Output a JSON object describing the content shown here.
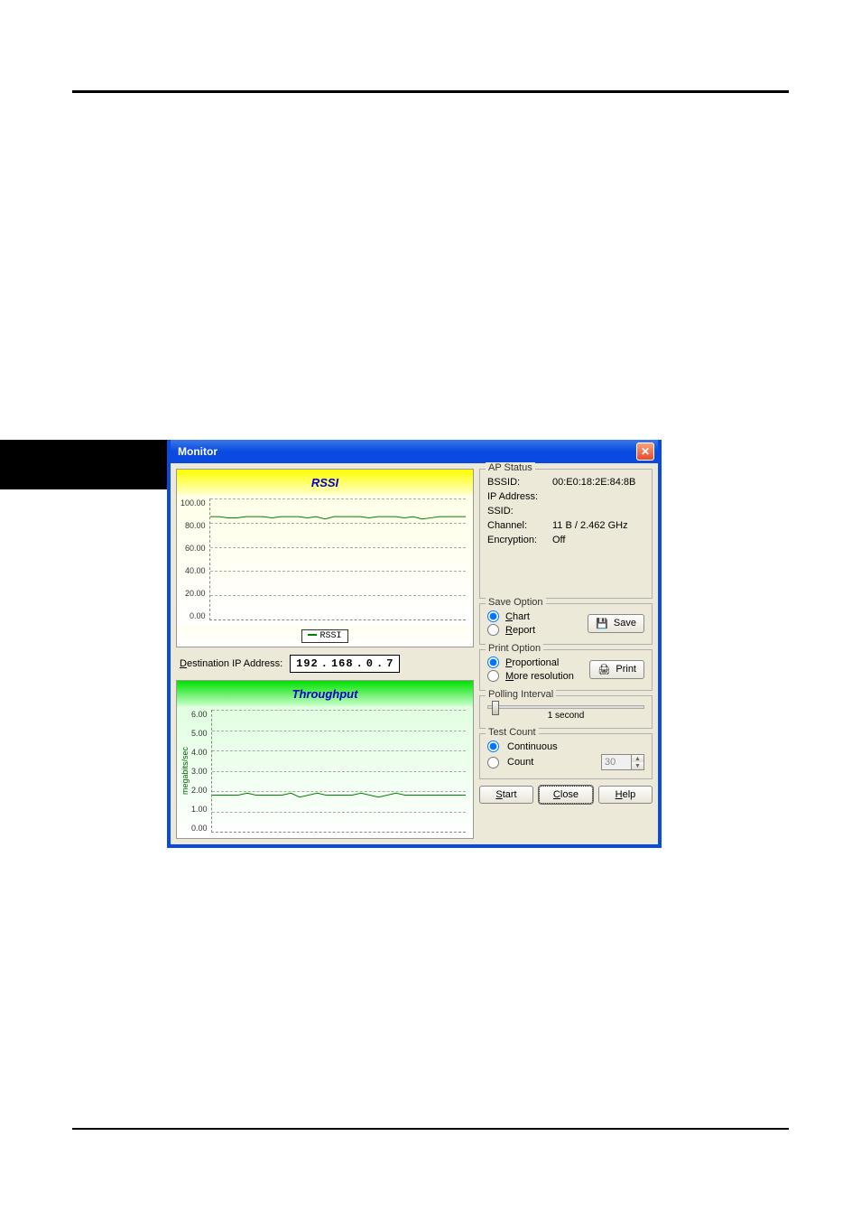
{
  "dialog": {
    "title": "Monitor"
  },
  "charts": {
    "rssi": {
      "title": "RSSI",
      "legend": "RSSI"
    },
    "throughput": {
      "title": "Throughput",
      "y_axis_label": "megabits/sec"
    }
  },
  "chart_data": [
    {
      "name": "rssi",
      "type": "line",
      "title": "RSSI",
      "ylabel": "",
      "ylim": [
        0,
        100
      ],
      "yticks": [
        100.0,
        80.0,
        60.0,
        40.0,
        20.0,
        0.0
      ],
      "x": [
        0,
        1,
        2,
        3,
        4,
        5,
        6,
        7,
        8,
        9,
        10,
        11,
        12,
        13,
        14,
        15,
        16,
        17,
        18,
        19,
        20,
        21,
        22,
        23,
        24,
        25,
        26,
        27,
        28,
        29
      ],
      "series": [
        {
          "name": "RSSI",
          "values": [
            85,
            85,
            84,
            84,
            85,
            85,
            85,
            84,
            85,
            85,
            85,
            84,
            85,
            83,
            85,
            85,
            85,
            85,
            84,
            85,
            85,
            85,
            84,
            85,
            83,
            84,
            85,
            85,
            85,
            85
          ]
        }
      ]
    },
    {
      "name": "throughput",
      "type": "line",
      "title": "Throughput",
      "ylabel": "megabits/sec",
      "ylim": [
        0,
        6
      ],
      "yticks": [
        6.0,
        5.0,
        4.0,
        3.0,
        2.0,
        1.0,
        0.0
      ],
      "x": [
        0,
        1,
        2,
        3,
        4,
        5,
        6,
        7,
        8,
        9,
        10,
        11,
        12,
        13,
        14,
        15,
        16,
        17,
        18,
        19,
        20,
        21,
        22,
        23,
        24,
        25,
        26,
        27,
        28,
        29
      ],
      "series": [
        {
          "name": "Throughput",
          "values": [
            1.8,
            1.8,
            1.8,
            1.8,
            1.9,
            1.8,
            1.8,
            1.8,
            1.8,
            1.9,
            1.7,
            1.8,
            1.9,
            1.8,
            1.8,
            1.8,
            1.8,
            1.9,
            1.8,
            1.7,
            1.8,
            1.9,
            1.8,
            1.8,
            1.8,
            1.8,
            1.8,
            1.8,
            1.8,
            1.8
          ]
        }
      ]
    }
  ],
  "ip": {
    "label": "estination IP Address:",
    "label_ul": "D",
    "octets": [
      "192",
      "168",
      "0",
      "7"
    ]
  },
  "ap_status": {
    "legend": "AP Status",
    "rows": [
      {
        "label": "BSSID:",
        "value": "00:E0:18:2E:84:8B"
      },
      {
        "label": "IP Address:",
        "value": ""
      },
      {
        "label": "SSID:",
        "value": ""
      },
      {
        "label": "Channel:",
        "value": "11 B / 2.462 GHz"
      },
      {
        "label": "Encryption:",
        "value": "Off"
      }
    ]
  },
  "save_option": {
    "legend": "Save Option",
    "chart_ul": "C",
    "chart_label": "hart",
    "report_ul": "R",
    "report_label": "eport",
    "button_ul": "S",
    "button_label": "ave"
  },
  "print_option": {
    "legend": "Print Option",
    "prop_ul": "P",
    "prop_label": "roportional",
    "more_ul": "M",
    "more_label": "ore resolution",
    "button_ul": "",
    "button_label": "Print"
  },
  "polling": {
    "legend": "Polling Interval",
    "value_text": "1 second"
  },
  "test_count": {
    "legend": "Test Count",
    "cont_ul": "",
    "cont_label": "Continuous",
    "count_ul": "",
    "count_label": "Count",
    "count_value": "30"
  },
  "buttons": {
    "start_ul": "S",
    "start_rest": "tart",
    "close_ul": "C",
    "close_rest": "lose",
    "help_ul": "H",
    "help_rest": "elp"
  },
  "icons": {
    "save": "💾",
    "print": "🖨",
    "close": "✕"
  }
}
